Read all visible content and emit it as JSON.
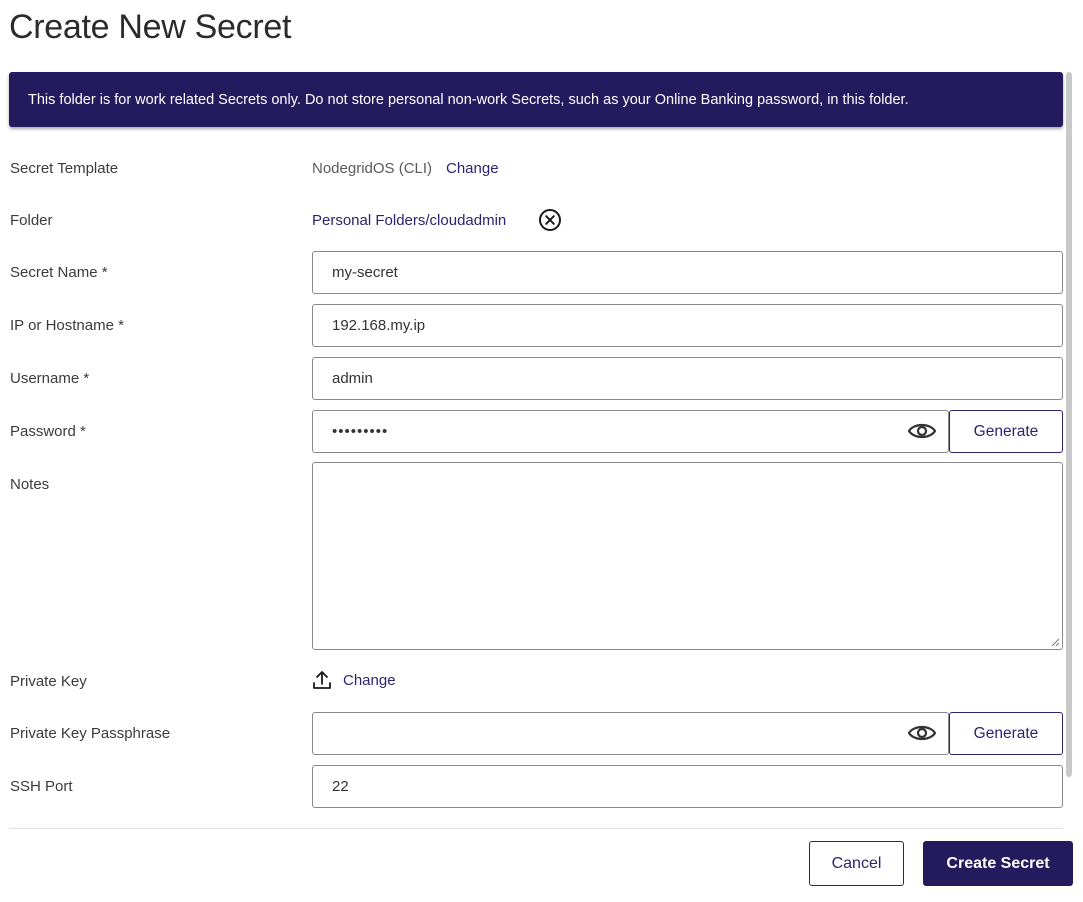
{
  "page": {
    "title": "Create New Secret"
  },
  "banner": {
    "text": "This folder is for work related Secrets only. Do not store personal non-work Secrets, such as your Online Banking password, in this folder."
  },
  "form": {
    "secret_template": {
      "label": "Secret Template",
      "value": "NodegridOS (CLI)",
      "change_label": "Change"
    },
    "folder": {
      "label": "Folder",
      "value": "Personal Folders/cloudadmin"
    },
    "secret_name": {
      "label": "Secret Name *",
      "value": "my-secret"
    },
    "ip_hostname": {
      "label": "IP or Hostname *",
      "value": "192.168.my.ip"
    },
    "username": {
      "label": "Username *",
      "value": "admin"
    },
    "password": {
      "label": "Password *",
      "value": "•••••••••",
      "generate_label": "Generate"
    },
    "notes": {
      "label": "Notes",
      "value": ""
    },
    "private_key": {
      "label": "Private Key",
      "change_label": "Change"
    },
    "private_key_passphrase": {
      "label": "Private Key Passphrase",
      "value": "",
      "generate_label": "Generate"
    },
    "ssh_port": {
      "label": "SSH Port",
      "value": "22"
    }
  },
  "footer": {
    "cancel_label": "Cancel",
    "create_label": "Create Secret"
  },
  "icons": {
    "clear": "close-circle-icon",
    "eye": "eye-icon",
    "upload": "upload-icon"
  },
  "colors": {
    "brand": "#241a5e",
    "link": "#2c2470",
    "border": "#8a8a8a"
  }
}
